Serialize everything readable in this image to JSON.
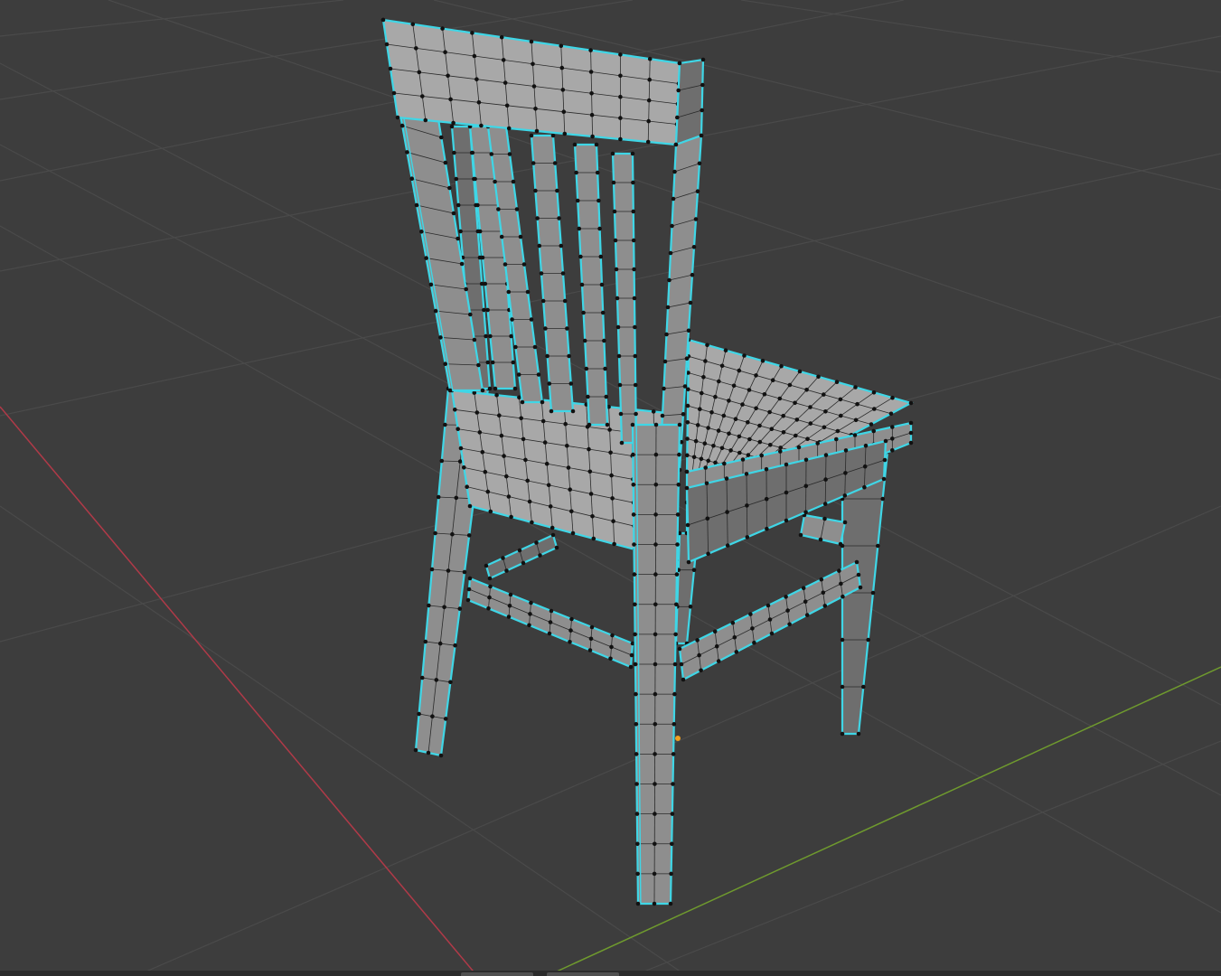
{
  "viewport": {
    "mode": "edit-mode",
    "object": "chair-mesh",
    "selection": "all-faces-selected",
    "show_grid": true,
    "show_axes": true
  },
  "colors": {
    "background": "#3d3d3d",
    "grid_line": "#4a4a4a",
    "axis_x": "#b03a48",
    "axis_y": "#6f9a2e",
    "mesh_face": "#8e8e8e",
    "mesh_face_dark": "#6e6e6e",
    "mesh_face_light": "#a8a8a8",
    "edge_selected": "#3fd6e6",
    "wire": "#2a2a2a",
    "vertex": "#111111",
    "origin": "#f0a020"
  }
}
